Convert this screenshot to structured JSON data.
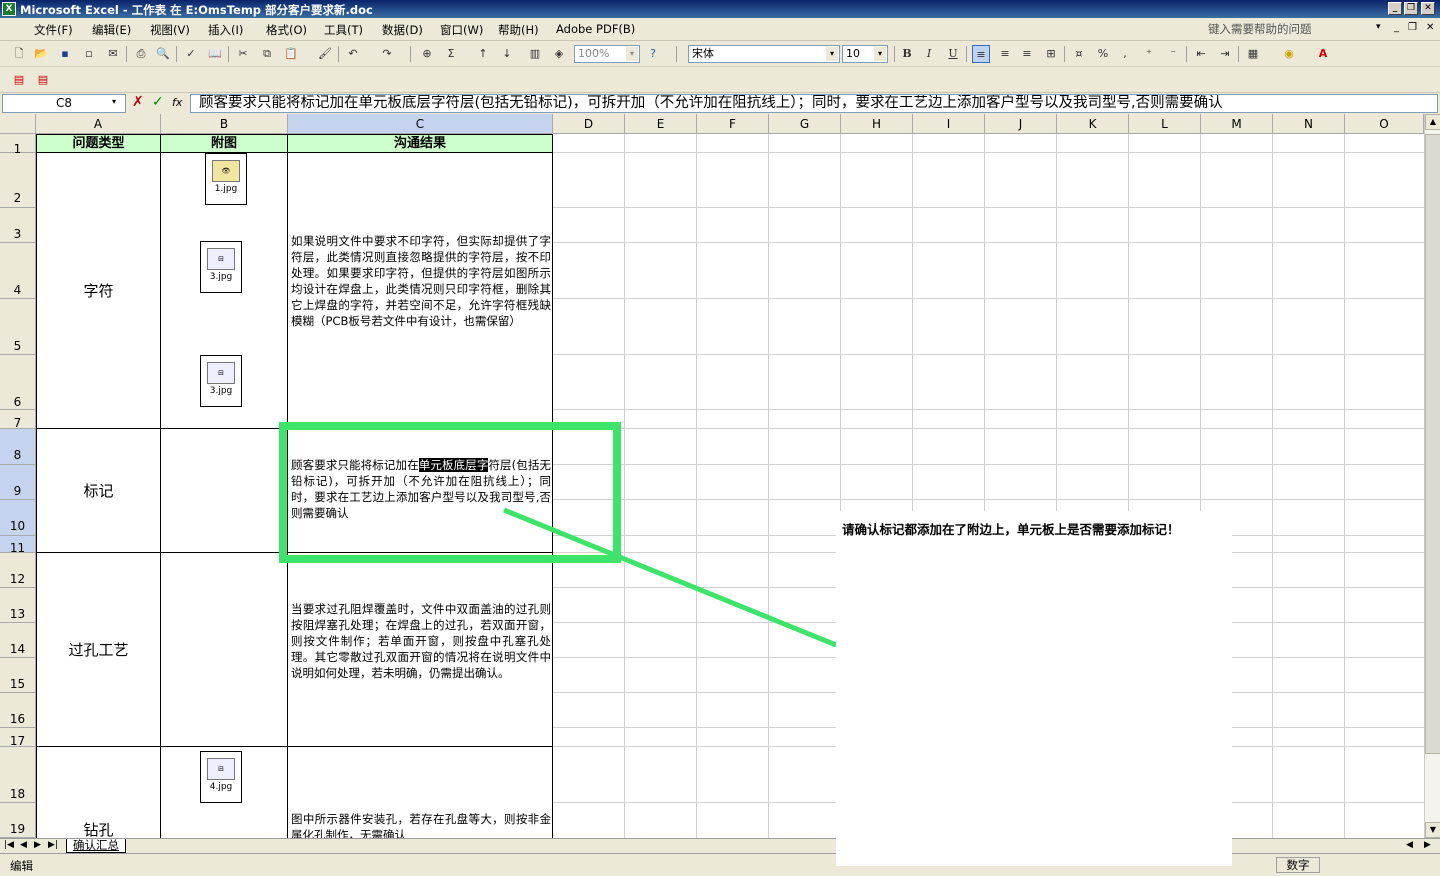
{
  "window": {
    "title": "Microsoft Excel - 工作表 在 E:OmsTemp 部分客户要求新.doc",
    "app_icon": "X"
  },
  "menu": [
    "文件(F)",
    "编辑(E)",
    "视图(V)",
    "插入(I)",
    "格式(O)",
    "工具(T)",
    "数据(D)",
    "窗口(W)",
    "帮助(H)",
    "Adobe PDF(B)"
  ],
  "help_search": {
    "placeholder": "键入需要帮助的问题"
  },
  "toolbar": {
    "zoom": "100%",
    "font": "宋体",
    "font_size": "10",
    "bold": "B",
    "italic": "I",
    "underline": "U"
  },
  "name_box": "C8",
  "formula": "顾客要求只能将标记加在单元板底层字符层(包括无铅标记)，可拆开加（不允许加在阻抗线上）；同时，要求在工艺边上添加客户型号以及我司型号,否则需要确认",
  "columns": [
    "A",
    "B",
    "C",
    "D",
    "E",
    "F",
    "G",
    "H",
    "I",
    "J",
    "K",
    "L",
    "M",
    "N",
    "O"
  ],
  "rows": [
    "1",
    "2",
    "3",
    "4",
    "5",
    "6",
    "7",
    "8",
    "9",
    "10",
    "11",
    "12",
    "13",
    "14",
    "15",
    "16",
    "17",
    "18",
    "19"
  ],
  "table": {
    "headers": [
      "问题类型",
      "附图",
      "沟通结果"
    ],
    "rows": [
      {
        "category": "字符",
        "files": [
          "1.jpg",
          "3.jpg",
          "3.jpg"
        ],
        "result": "如果说明文件中要求不印字符，但实际却提供了字符层，此类情况则直接忽略提供的字符层，按不印处理。如果要求印字符，但提供的字符层如图所示均设计在焊盘上，此类情况则只印字符框，删除其它上焊盘的字符，并若空间不足，允许字符框残缺模糊（PCB板号若文件中有设计，也需保留）"
      },
      {
        "category": "标记",
        "files": [],
        "result_pre": "顾客要求只能将标记加在",
        "result_selected": "单元板底层字",
        "result_post": "符层(包括无铅标记)，可拆开加（不允许加在阻抗线上）；同时，要求在工艺边上添加客户型号以及我司型号,否则需要确认"
      },
      {
        "category": "过孔工艺",
        "files": [],
        "result": "当要求过孔阻焊覆盖时，文件中双面盖油的过孔则按阻焊塞孔处理；在焊盘上的过孔，若双面开窗，则按文件制作；若单面开窗，则按盘中孔塞孔处理。其它零散过孔双面开窗的情况将在说明文件中说明如何处理，若未明确，仍需提出确认。"
      },
      {
        "category": "钻孔",
        "files": [
          "4.jpg"
        ],
        "result": "图中所示器件安装孔，若存在孔盘等大，则按非金属化孔制作，无需确认"
      }
    ]
  },
  "annotation": {
    "text": "请确认标记都添加在了附边上，单元板上是否需要添加标记！",
    "box_color": "#3ee36a"
  },
  "sheet_tab": "确认汇总",
  "status": {
    "mode": "编辑",
    "num": "数字"
  }
}
